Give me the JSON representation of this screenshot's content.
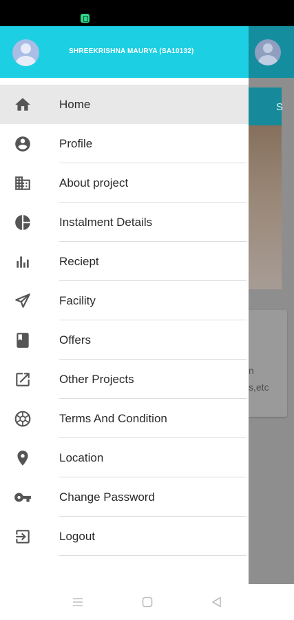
{
  "drawer": {
    "user_name": "SHREEKRISHNA MAURYA (SA10132)",
    "items": [
      {
        "label": "Home",
        "icon": "home-icon",
        "active": true
      },
      {
        "label": "Profile",
        "icon": "account-circle-icon"
      },
      {
        "label": "About project",
        "icon": "building-icon"
      },
      {
        "label": "Instalment Details",
        "icon": "pie-chart-icon"
      },
      {
        "label": "Reciept",
        "icon": "bar-chart-icon"
      },
      {
        "label": "Facility",
        "icon": "paper-plane-icon"
      },
      {
        "label": "Offers",
        "icon": "book-icon"
      },
      {
        "label": "Other Projects",
        "icon": "open-in-new-icon"
      },
      {
        "label": "Terms And Condition",
        "icon": "aperture-icon"
      },
      {
        "label": "Location",
        "icon": "location-pin-icon"
      },
      {
        "label": "Change Password",
        "icon": "key-icon"
      },
      {
        "label": "Logout",
        "icon": "logout-icon"
      }
    ]
  },
  "background": {
    "tab_letter": "S",
    "card_line1": "n",
    "card_line2": "s,etc"
  },
  "colors": {
    "header": "#1ccfe3",
    "active_item": "#e8e8e8",
    "icon": "#555555"
  }
}
